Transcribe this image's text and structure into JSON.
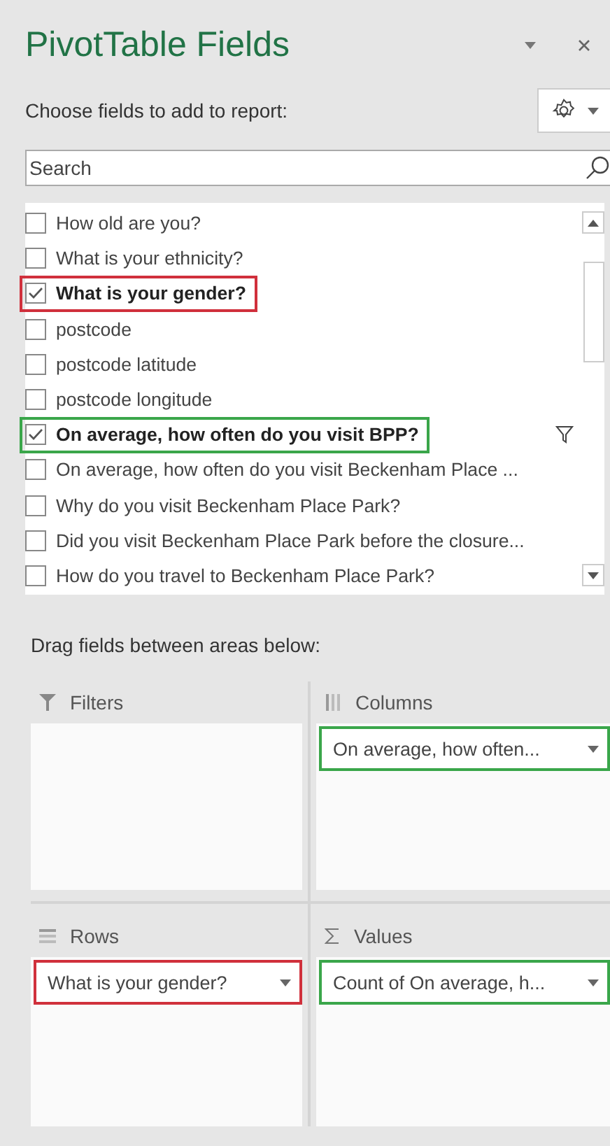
{
  "panel": {
    "title": "PivotTable Fields",
    "subtitle": "Choose fields to add to report:"
  },
  "search": {
    "placeholder": "Search"
  },
  "fields": [
    {
      "label": "How old are you?",
      "checked": false,
      "filtered": false
    },
    {
      "label": "What is your ethnicity?",
      "checked": false,
      "filtered": false
    },
    {
      "label": "What is your gender?",
      "checked": true,
      "filtered": false,
      "color": "#d0303c"
    },
    {
      "label": "postcode",
      "checked": false,
      "filtered": false
    },
    {
      "label": "postcode latitude",
      "checked": false,
      "filtered": false
    },
    {
      "label": "postcode longitude",
      "checked": false,
      "filtered": false
    },
    {
      "label": "On average, how often do you visit BPP?",
      "checked": true,
      "filtered": true,
      "color": "#3aa64a"
    },
    {
      "label": "On average, how often do you visit Beckenham Place ...",
      "checked": false,
      "filtered": false
    },
    {
      "label": "Why do you visit Beckenham Place Park?",
      "checked": false,
      "filtered": false
    },
    {
      "label": "Did you visit Beckenham Place Park before the closure...",
      "checked": false,
      "filtered": false
    },
    {
      "label": "How do you travel to Beckenham Place Park?",
      "checked": false,
      "filtered": false
    }
  ],
  "areas_heading": "Drag fields between areas below:",
  "areas": [
    {
      "kind": "filters",
      "label": "Filters"
    },
    {
      "kind": "columns",
      "label": "Columns",
      "items": [
        {
          "text": "On average, how often...",
          "color": "#3aa64a"
        }
      ]
    },
    {
      "kind": "rows",
      "label": "Rows",
      "items": [
        {
          "text": "What is your gender?",
          "color": "#d0303c"
        }
      ]
    },
    {
      "kind": "values",
      "label": "Values",
      "items": [
        {
          "text": "Count of On average, h...",
          "color": "#3aa64a"
        }
      ]
    }
  ]
}
